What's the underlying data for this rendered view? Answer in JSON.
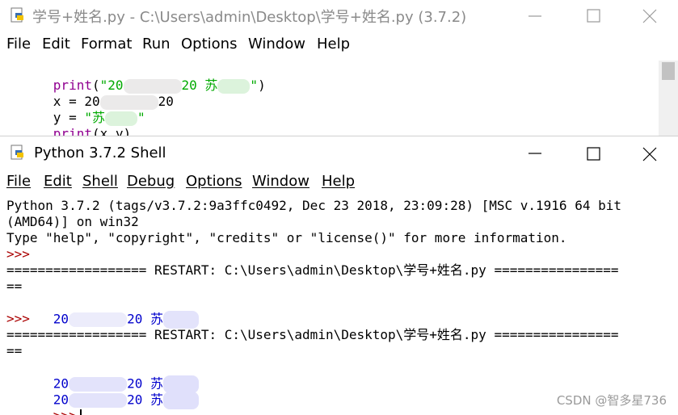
{
  "editor": {
    "title": "学号+姓名.py - C:\\Users\\admin\\Desktop\\学号+姓名.py (3.7.2)",
    "menu": [
      "File",
      "Edit",
      "Format",
      "Run",
      "Options",
      "Window",
      "Help"
    ],
    "code": {
      "l1_fn": "print",
      "l1_open": "(",
      "l1_s1": "\"20",
      "l1_s2": "20 苏",
      "l1_s3": "\"",
      "l1_close": ")",
      "l2_a": "x = 20",
      "l2_b": "20",
      "l3_a": "y = ",
      "l3_s1": "\"苏",
      "l3_s2": "\"",
      "l4_fn": "print",
      "l4_rest": "(x,y)"
    }
  },
  "shell": {
    "title": "Python 3.7.2 Shell",
    "menu": [
      "File",
      "Edit",
      "Shell",
      "Debug",
      "Options",
      "Window",
      "Help"
    ],
    "banner1": "Python 3.7.2 (tags/v3.7.2:9a3ffc0492, Dec 23 2018, 23:09:28) [MSC v.1916 64 bit",
    "banner2": "(AMD64)] on win32",
    "banner3": "Type \"help\", \"copyright\", \"credits\" or \"license()\" for more information.",
    "prompt": ">>>",
    "restart": "================== RESTART: C:\\Users\\admin\\Desktop\\学号+姓名.py ================",
    "restart_wrap": "==",
    "out_a": "20",
    "out_b": "20 苏"
  },
  "watermark": "CSDN @智多星736",
  "colors": {
    "keyword": "#900090",
    "string": "#00aa00",
    "output": "#0000cc",
    "prompt": "#aa0000"
  }
}
